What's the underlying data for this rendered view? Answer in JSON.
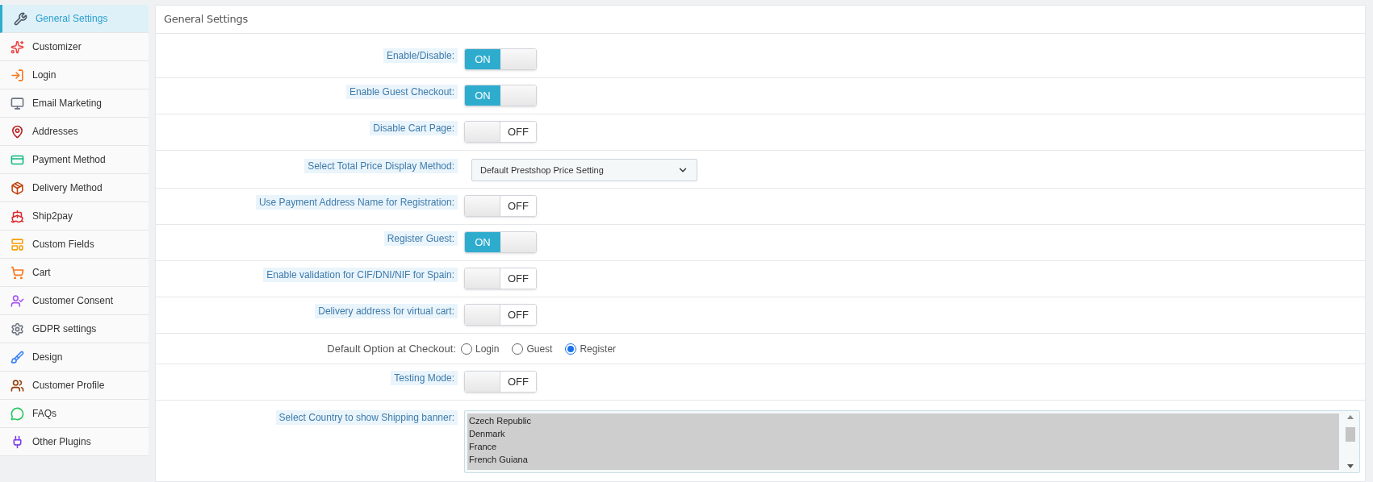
{
  "sidebar": {
    "items": [
      {
        "label": "General Settings",
        "selected": true
      },
      {
        "label": "Customizer",
        "selected": false
      },
      {
        "label": "Login",
        "selected": false
      },
      {
        "label": "Email Marketing",
        "selected": false
      },
      {
        "label": "Addresses",
        "selected": false
      },
      {
        "label": "Payment Method",
        "selected": false
      },
      {
        "label": "Delivery Method",
        "selected": false
      },
      {
        "label": "Ship2pay",
        "selected": false
      },
      {
        "label": "Custom Fields",
        "selected": false
      },
      {
        "label": "Cart",
        "selected": false
      },
      {
        "label": "Customer Consent",
        "selected": false
      },
      {
        "label": "GDPR settings",
        "selected": false
      },
      {
        "label": "Design",
        "selected": false
      },
      {
        "label": "Customer Profile",
        "selected": false
      },
      {
        "label": "FAQs",
        "selected": false
      },
      {
        "label": "Other Plugins",
        "selected": false
      }
    ]
  },
  "panel": {
    "title": "General Settings",
    "rows": [
      {
        "kind": "toggle",
        "label": "Enable/Disable:",
        "on": true,
        "text": "ON"
      },
      {
        "kind": "toggle",
        "label": "Enable Guest Checkout:",
        "on": true,
        "text": "ON"
      },
      {
        "kind": "toggle",
        "label": "Disable Cart Page:",
        "on": false,
        "text": "OFF"
      },
      {
        "kind": "select",
        "label": "Select Total Price Display Method:",
        "value": "Default Prestshop Price Setting"
      },
      {
        "kind": "toggle",
        "label": "Use Payment Address Name for Registration:",
        "on": false,
        "text": "OFF"
      },
      {
        "kind": "toggle",
        "label": "Register Guest:",
        "on": true,
        "text": "ON"
      },
      {
        "kind": "toggle",
        "label": "Enable validation for CIF/DNI/NIF for Spain:",
        "on": false,
        "text": "OFF"
      },
      {
        "kind": "toggle",
        "label": "Delivery address for virtual cart:",
        "on": false,
        "text": "OFF"
      },
      {
        "kind": "radio",
        "label": "Default Option at Checkout:",
        "options": [
          {
            "label": "Login",
            "selected": false
          },
          {
            "label": "Guest",
            "selected": false
          },
          {
            "label": "Register",
            "selected": true
          }
        ]
      },
      {
        "kind": "toggle",
        "label": "Testing Mode:",
        "on": false,
        "text": "OFF"
      },
      {
        "kind": "listbox",
        "label": "Select Country to show Shipping banner:",
        "options": [
          {
            "label": "Czech Republic",
            "selected": true
          },
          {
            "label": "Denmark",
            "selected": true
          },
          {
            "label": "France",
            "selected": true
          },
          {
            "label": "French Guiana",
            "selected": true
          }
        ]
      }
    ]
  }
}
